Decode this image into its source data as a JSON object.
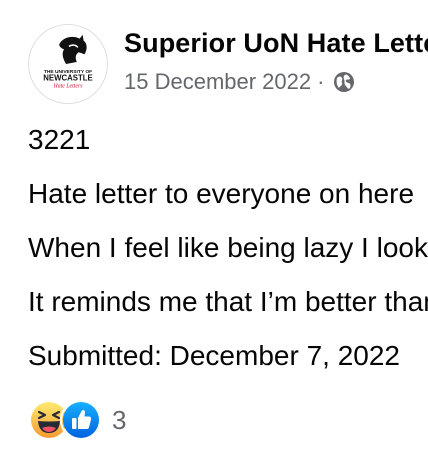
{
  "post": {
    "page_name": "Superior UoN Hate Letters",
    "date": "15 December 2022",
    "separator": "·",
    "privacy_icon": "globe-icon",
    "avatar": {
      "line1": "THE UNIVERSITY OF",
      "line2": "NEWCASTLE",
      "line3": "Hate Letters"
    },
    "lines": [
      "3221",
      "Hate letter to everyone on here",
      "When I feel like being lazy I look",
      "It reminds me that I’m better than",
      "Submitted:  December 7, 2022"
    ],
    "reactions": {
      "icons": [
        "haha-icon",
        "like-icon"
      ],
      "count": "3"
    }
  },
  "colors": {
    "text_primary": "#050505",
    "text_secondary": "#65676b",
    "like_blue": "#1877f2",
    "haha_yellow": "#f7b125",
    "logo_red": "#c8102e"
  }
}
